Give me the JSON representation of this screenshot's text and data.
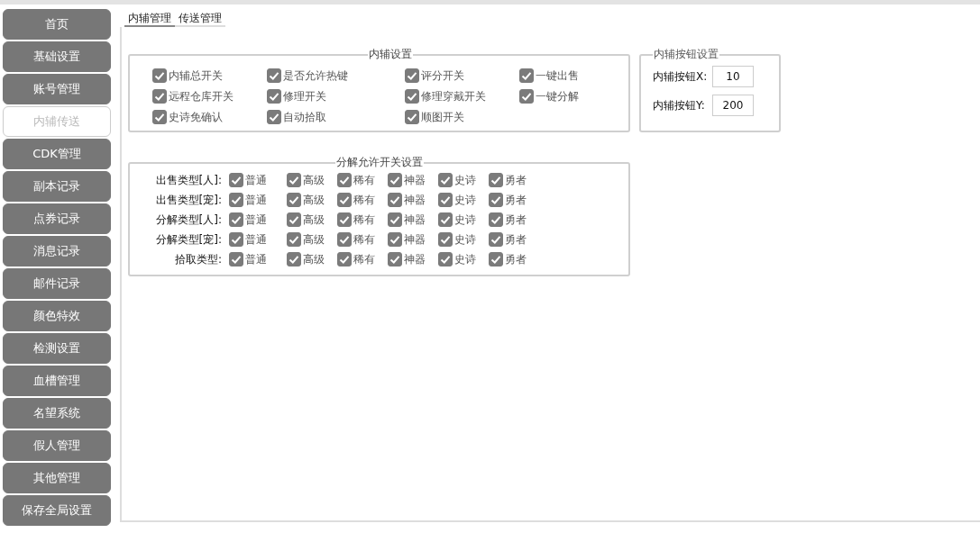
{
  "sidebar": {
    "items": [
      {
        "label": "首页",
        "selected": false
      },
      {
        "label": "基础设置",
        "selected": false
      },
      {
        "label": "账号管理",
        "selected": false
      },
      {
        "label": "内辅传送",
        "selected": true
      },
      {
        "label": "CDK管理",
        "selected": false
      },
      {
        "label": "副本记录",
        "selected": false
      },
      {
        "label": "点券记录",
        "selected": false
      },
      {
        "label": "消息记录",
        "selected": false
      },
      {
        "label": "邮件记录",
        "selected": false
      },
      {
        "label": "颜色特效",
        "selected": false
      },
      {
        "label": "检测设置",
        "selected": false
      },
      {
        "label": "血槽管理",
        "selected": false
      },
      {
        "label": "名望系统",
        "selected": false
      },
      {
        "label": "假人管理",
        "selected": false
      },
      {
        "label": "其他管理",
        "selected": false
      },
      {
        "label": "保存全局设置",
        "selected": false
      }
    ]
  },
  "tabs": [
    {
      "label": "内辅管理",
      "selected": true
    },
    {
      "label": "传送管理",
      "selected": false
    }
  ],
  "assist_settings": {
    "title": "内辅设置",
    "options": [
      {
        "label": "内辅总开关",
        "checked": true
      },
      {
        "label": "是否允许热键",
        "checked": true
      },
      {
        "label": "评分开关",
        "checked": true
      },
      {
        "label": "一键出售",
        "checked": true
      },
      {
        "label": "远程仓库开关",
        "checked": true
      },
      {
        "label": "修理开关",
        "checked": true
      },
      {
        "label": "修理穿戴开关",
        "checked": true
      },
      {
        "label": "一键分解",
        "checked": true
      },
      {
        "label": "史诗免确认",
        "checked": true
      },
      {
        "label": "自动拾取",
        "checked": true
      },
      {
        "label": "顺图开关",
        "checked": true
      }
    ]
  },
  "button_settings": {
    "title": "内辅按钮设置",
    "fields": [
      {
        "label": "内辅按钮X:",
        "value": "10"
      },
      {
        "label": "内辅按钮Y:",
        "value": "200"
      }
    ]
  },
  "decompose_settings": {
    "title": "分解允许开关设置",
    "rows": [
      {
        "label": "出售类型[人]:",
        "options": [
          {
            "label": "普通",
            "checked": true
          },
          {
            "label": "高级",
            "checked": true
          },
          {
            "label": "稀有",
            "checked": true
          },
          {
            "label": "神器",
            "checked": true
          },
          {
            "label": "史诗",
            "checked": true
          },
          {
            "label": "勇者",
            "checked": true
          }
        ]
      },
      {
        "label": "出售类型[宠]:",
        "options": [
          {
            "label": "普通",
            "checked": true
          },
          {
            "label": "高级",
            "checked": true
          },
          {
            "label": "稀有",
            "checked": true
          },
          {
            "label": "神器",
            "checked": true
          },
          {
            "label": "史诗",
            "checked": true
          },
          {
            "label": "勇者",
            "checked": true
          }
        ]
      },
      {
        "label": "分解类型[人]:",
        "options": [
          {
            "label": "普通",
            "checked": true
          },
          {
            "label": "高级",
            "checked": true
          },
          {
            "label": "稀有",
            "checked": true
          },
          {
            "label": "神器",
            "checked": true
          },
          {
            "label": "史诗",
            "checked": true
          },
          {
            "label": "勇者",
            "checked": true
          }
        ]
      },
      {
        "label": "分解类型[宠]:",
        "options": [
          {
            "label": "普通",
            "checked": true
          },
          {
            "label": "高级",
            "checked": true
          },
          {
            "label": "稀有",
            "checked": true
          },
          {
            "label": "神器",
            "checked": true
          },
          {
            "label": "史诗",
            "checked": true
          },
          {
            "label": "勇者",
            "checked": true
          }
        ]
      },
      {
        "label": "拾取类型:",
        "options": [
          {
            "label": "普通",
            "checked": true
          },
          {
            "label": "高级",
            "checked": true
          },
          {
            "label": "稀有",
            "checked": true
          },
          {
            "label": "神器",
            "checked": true
          },
          {
            "label": "史诗",
            "checked": true
          },
          {
            "label": "勇者",
            "checked": true
          }
        ]
      }
    ]
  }
}
